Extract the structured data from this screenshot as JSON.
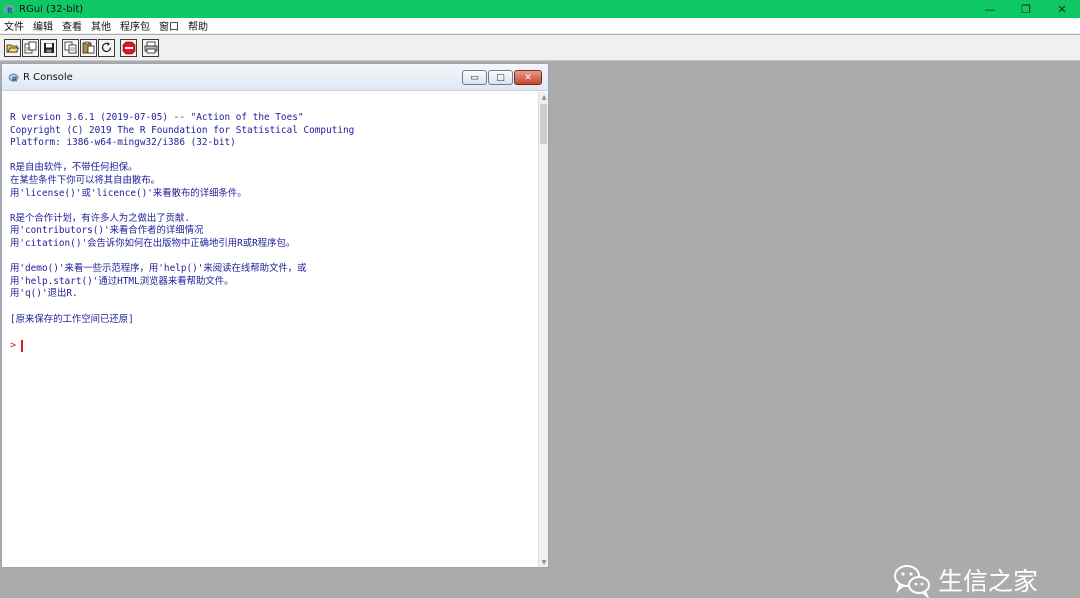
{
  "window": {
    "title": "RGui (32-bit)",
    "controls": {
      "minimize": "—",
      "restore": "❐",
      "close": "✕"
    }
  },
  "menu": {
    "items": [
      "文件",
      "编辑",
      "查看",
      "其他",
      "程序包",
      "窗口",
      "帮助"
    ]
  },
  "toolbar": {
    "buttons": [
      "open-script-icon",
      "load-workspace-icon",
      "save-workspace-icon",
      "copy-icon",
      "paste-icon",
      "copy-paste-icon",
      "stop-icon",
      "print-icon"
    ]
  },
  "console": {
    "title": "R Console",
    "controls": {
      "minimize": "▭",
      "maximize": "□",
      "close": "✕"
    },
    "lines": [
      "R version 3.6.1 (2019-07-05) -- \"Action of the Toes\"",
      "Copyright (C) 2019 The R Foundation for Statistical Computing",
      "Platform: i386-w64-mingw32/i386 (32-bit)",
      "",
      "R是自由软件，不带任何担保。",
      "在某些条件下你可以将其自由散布。",
      "用'license()'或'licence()'来看散布的详细条件。",
      "",
      "R是个合作计划，有许多人为之做出了贡献.",
      "用'contributors()'来看合作者的详细情况",
      "用'citation()'会告诉你如何在出版物中正确地引用R或R程序包。",
      "",
      "用'demo()'来看一些示范程序，用'help()'来阅读在线帮助文件，或",
      "用'help.start()'通过HTML浏览器来看帮助文件。",
      "用'q()'退出R.",
      "",
      "[原来保存的工作空间已还原]",
      ""
    ],
    "prompt": ">"
  },
  "watermark": {
    "text": "生信之家"
  }
}
